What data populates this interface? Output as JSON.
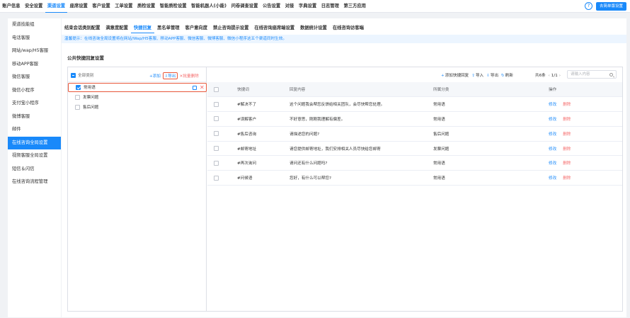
{
  "topnav": {
    "items": [
      "账户信息",
      "安全设置",
      "渠道设置",
      "座席设置",
      "客户设置",
      "工单设置",
      "质检设置",
      "智能质检设置",
      "智能机器人(小能)",
      "问卷调查设置",
      "公告设置",
      "对接",
      "字典设置",
      "日志管理",
      "第三方应用"
    ],
    "active_index": 2,
    "help_icon": "question-circle-icon",
    "right_button": "去简单版设置"
  },
  "sidebar": {
    "items": [
      "渠道技能组",
      "电话客服",
      "网站/wap/H5客服",
      "移动APP客服",
      "微信客服",
      "微信小程序",
      "支付宝小程序",
      "微博客服",
      "邮件",
      "在线咨询全局设置",
      "视频客服全局设置",
      "短信＆闪信",
      "在线咨询流程管理"
    ],
    "active_index": 9
  },
  "subtabs": {
    "items": [
      "结束会话类别配置",
      "满意度配置",
      "快捷回复",
      "黑名单管理",
      "客户意向度",
      "禁止咨询提示设置",
      "在线咨询座席端设置",
      "数据统计设置",
      "在线咨询访客端"
    ],
    "active_index": 2
  },
  "notice": "温馨提示：在线咨询全局设置将在网站/Wap/H5客服、移动APP客服、微信客服、微博客服、微信小程序这五个渠道同时生效。",
  "section_title": "公共快捷回复设置",
  "categories": {
    "all_label": "全部类别",
    "add_label": "+添加",
    "export_label": "导出",
    "batch_delete_label": "✕批量删除",
    "items": [
      {
        "label": "常用语",
        "checked": true,
        "selected": true
      },
      {
        "label": "发票问题",
        "checked": false,
        "selected": false
      },
      {
        "label": "售后问题",
        "checked": false,
        "selected": false
      }
    ]
  },
  "table_toolbar": {
    "add_label": "添加快捷回复",
    "import_label": "导入",
    "export_label": "导出",
    "refresh_label": "刷新",
    "total": "共6条",
    "page": "1/1",
    "search_placeholder": "请输入内容"
  },
  "table": {
    "columns": [
      "快捷词",
      "回复内容",
      "所属分类",
      "操作"
    ],
    "edit_label": "修改",
    "delete_label": "删除",
    "rows": [
      {
        "keyword": "#解决不了",
        "content": "这个问题我会帮您反馈给相关团队，会尽快帮您处理。",
        "category": "常用语"
      },
      {
        "keyword": "#误解客户",
        "content": "不好意思，刚刚我理解有偏差。",
        "category": "常用语"
      },
      {
        "keyword": "#售后咨询",
        "content": "请描述您的问题?",
        "category": "售后问题"
      },
      {
        "keyword": "#邮寄地址",
        "content": "请您提供邮寄地址，我们安排相关人员尽快给您邮寄",
        "category": "发票问题"
      },
      {
        "keyword": "#再次询问",
        "content": "请问还有什么问题吗?",
        "category": "常用语"
      },
      {
        "keyword": "#问候语",
        "content": "您好，有什么可以帮您?",
        "category": "常用语"
      }
    ]
  },
  "colors": {
    "accent": "#1989fa",
    "danger": "#f56c6c",
    "highlight": "#e8573a"
  }
}
